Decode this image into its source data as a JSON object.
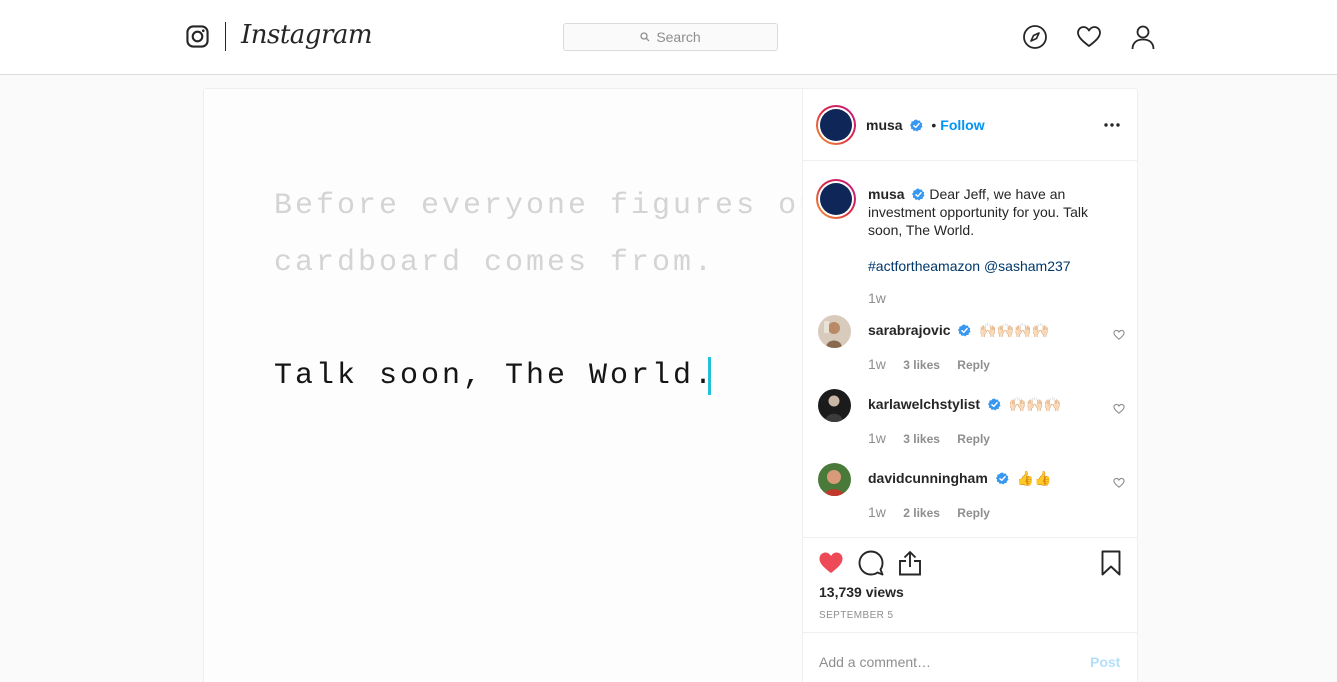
{
  "nav": {
    "brand": "Instagram",
    "search_placeholder": "Search"
  },
  "post": {
    "media_lines": [
      "Before everyone figures out where all that",
      "cardboard comes from.",
      "Talk soon, The World."
    ],
    "author": {
      "username": "musa",
      "follow_label": "Follow",
      "dot": "•"
    },
    "caption": {
      "text": "Dear Jeff, we have an investment opportunity for you. Talk soon, The World.",
      "tags": "#actfortheamazon @sasham237",
      "time": "1w"
    },
    "comments": [
      {
        "username": "sarabrajovic",
        "emoji": "🙌🏻🙌🏻🙌🏻🙌🏻",
        "time": "1w",
        "likes": "3 likes",
        "reply": "Reply"
      },
      {
        "username": "karlawelchstylist",
        "emoji": "🙌🏻🙌🏻🙌🏻",
        "time": "1w",
        "likes": "3 likes",
        "reply": "Reply"
      },
      {
        "username": "davidcunningham",
        "emoji": "👍👍",
        "time": "1w",
        "likes": "2 likes",
        "reply": "Reply"
      }
    ],
    "views": "13,739 views",
    "date": "SEPTEMBER 5",
    "comment_placeholder": "Add a comment…",
    "post_label": "Post"
  },
  "colors": {
    "verified": "#3897f0",
    "like_red": "#ed4956",
    "link_blue": "#0095f6",
    "cursor": "#22c1d8"
  }
}
